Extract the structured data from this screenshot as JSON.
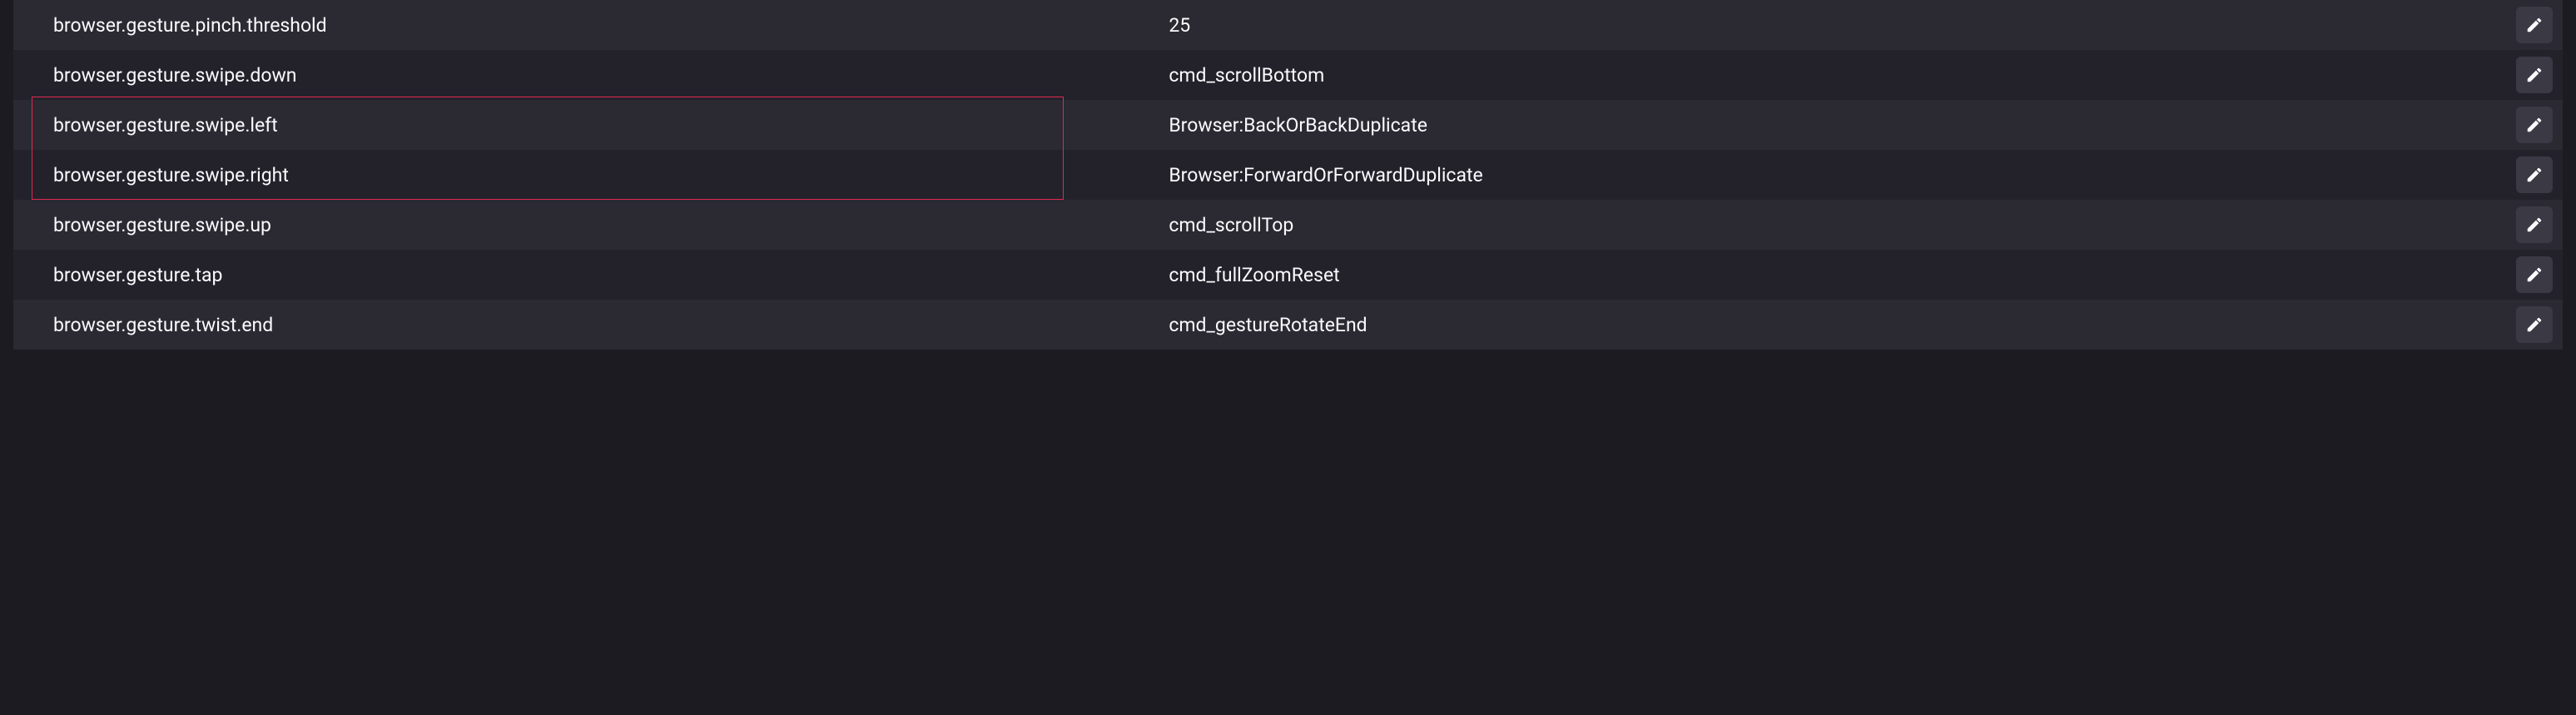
{
  "prefs": [
    {
      "name": "browser.gesture.pinch.threshold",
      "value": "25",
      "stripe": "odd"
    },
    {
      "name": "browser.gesture.swipe.down",
      "value": "cmd_scrollBottom",
      "stripe": "even"
    },
    {
      "name": "browser.gesture.swipe.left",
      "value": "Browser:BackOrBackDuplicate",
      "stripe": "odd"
    },
    {
      "name": "browser.gesture.swipe.right",
      "value": "Browser:ForwardOrForwardDuplicate",
      "stripe": "even"
    },
    {
      "name": "browser.gesture.swipe.up",
      "value": "cmd_scrollTop",
      "stripe": "odd"
    },
    {
      "name": "browser.gesture.tap",
      "value": "cmd_fullZoomReset",
      "stripe": "even"
    },
    {
      "name": "browser.gesture.twist.end",
      "value": "cmd_gestureRotateEnd",
      "stripe": "odd"
    }
  ],
  "highlighted_rows": [
    2,
    3
  ]
}
